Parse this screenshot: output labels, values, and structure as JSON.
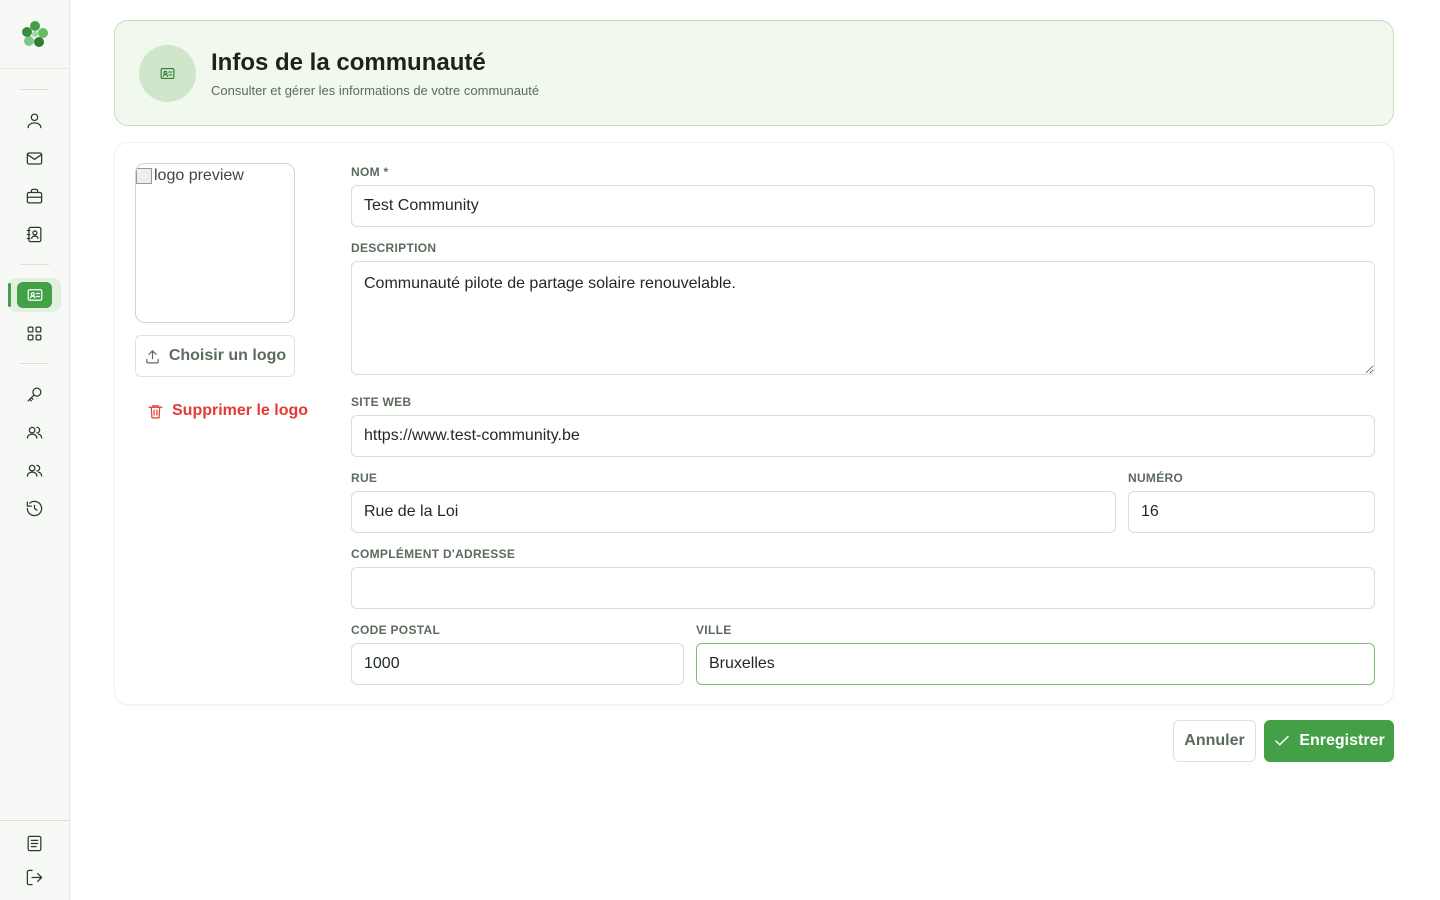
{
  "header": {
    "title": "Infos de la communauté",
    "subtitle": "Consulter et gérer les informations de votre communauté",
    "icon": "id-card-icon"
  },
  "sidebar": {
    "logo": "clover-logo",
    "items": [
      {
        "icon": "user-icon"
      },
      {
        "icon": "mail-icon"
      },
      {
        "icon": "briefcase-icon"
      },
      {
        "icon": "contact-book-icon"
      },
      {
        "icon": "id-card-icon",
        "active": true
      },
      {
        "icon": "grid-icon"
      },
      {
        "icon": "key-icon"
      },
      {
        "icon": "users-icon"
      },
      {
        "icon": "users-icon"
      },
      {
        "icon": "history-icon"
      }
    ],
    "footer": [
      {
        "icon": "document-icon"
      },
      {
        "icon": "logout-icon"
      }
    ]
  },
  "logo_panel": {
    "preview_alt": "logo preview",
    "choose_label": "Choisir un logo",
    "delete_label": "Supprimer le logo"
  },
  "form": {
    "name": {
      "label": "NOM *",
      "value": "Test Community"
    },
    "description": {
      "label": "DESCRIPTION",
      "value": "Communauté pilote de partage solaire renouvelable."
    },
    "website": {
      "label": "SITE WEB",
      "value": "https://www.test-community.be"
    },
    "street": {
      "label": "RUE",
      "value": "Rue de la Loi"
    },
    "number": {
      "label": "NUMÉRO",
      "value": "16"
    },
    "address_complement": {
      "label": "COMPLÉMENT D'ADRESSE",
      "value": ""
    },
    "postal_code": {
      "label": "CODE POSTAL",
      "value": "1000"
    },
    "city": {
      "label": "VILLE",
      "value": "Bruxelles"
    }
  },
  "actions": {
    "cancel_label": "Annuler",
    "save_label": "Enregistrer"
  },
  "colors": {
    "accent": "#43a047",
    "danger": "#e53935",
    "header_bg": "#f1f9ef"
  }
}
